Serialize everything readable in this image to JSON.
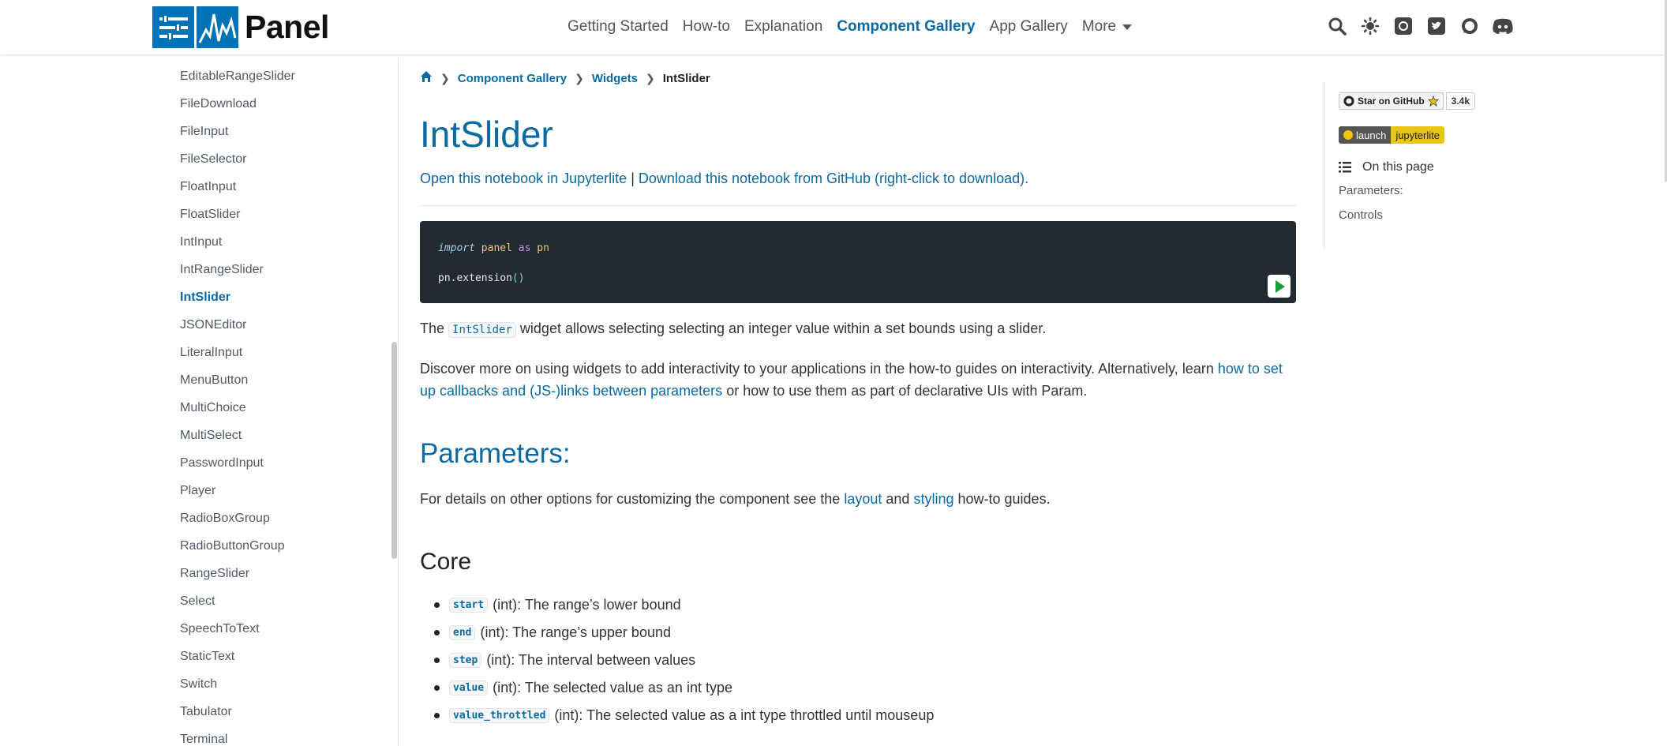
{
  "header": {
    "logo_text": "Panel",
    "nav": [
      {
        "label": "Getting Started"
      },
      {
        "label": "How-to"
      },
      {
        "label": "Explanation"
      },
      {
        "label": "Component Gallery",
        "active": true
      },
      {
        "label": "App Gallery"
      }
    ],
    "more_label": "More",
    "icons": [
      "search-icon",
      "theme-toggle-icon",
      "github-icon",
      "twitter-icon",
      "discourse-icon",
      "discord-icon"
    ]
  },
  "sidebar": {
    "items": [
      "EditableRangeSlider",
      "FileDownload",
      "FileInput",
      "FileSelector",
      "FloatInput",
      "FloatSlider",
      "IntInput",
      "IntRangeSlider",
      "IntSlider",
      "JSONEditor",
      "LiteralInput",
      "MenuButton",
      "MultiChoice",
      "MultiSelect",
      "PasswordInput",
      "Player",
      "RadioBoxGroup",
      "RadioButtonGroup",
      "RangeSlider",
      "Select",
      "SpeechToText",
      "StaticText",
      "Switch",
      "Tabulator",
      "Terminal"
    ],
    "current": "IntSlider"
  },
  "breadcrumb": {
    "items": [
      "Component Gallery",
      "Widgets"
    ],
    "current": "IntSlider"
  },
  "page": {
    "title": "IntSlider",
    "link_jupyterlite": "Open this notebook in Jupyterlite",
    "separator": "|",
    "link_github": "Download this notebook from GitHub (right-click to download).",
    "code": {
      "line1_kw": "import",
      "line1_mod": "panel",
      "line1_as": "as",
      "line1_alias": "pn",
      "line2_obj": "pn.extension",
      "line2_paren": "()"
    },
    "intro_pre": "The",
    "intro_code": "IntSlider",
    "intro_post": "widget allows selecting selecting an integer value within a set bounds using a slider.",
    "discover_text": "Discover more on using widgets to add interactivity to your applications in the how-to guides on interactivity. Alternatively, learn",
    "discover_link": "how to set up callbacks and (JS-)links between parameters",
    "discover_post": "or how to use them as part of declarative UIs with Param.",
    "parameters_heading": "Parameters:",
    "details_pre": "For details on other options for customizing the component see the",
    "details_link1": "layout",
    "details_and": "and",
    "details_link2": "styling",
    "details_post": "how-to guides.",
    "core_heading": "Core",
    "params": [
      {
        "name": "start",
        "desc": "(int): The range’s lower bound"
      },
      {
        "name": "end",
        "desc": "(int): The range’s upper bound"
      },
      {
        "name": "step",
        "desc": "(int): The interval between values"
      },
      {
        "name": "value",
        "desc": "(int): The selected value as an int type"
      },
      {
        "name": "value_throttled",
        "desc": "(int): The selected value as a int type throttled until mouseup"
      }
    ]
  },
  "toc": {
    "github_label": "Star on GitHub",
    "github_count": "3.4k",
    "launch_label": "launch",
    "jupyterlite_label": "jupyterlite",
    "heading": "On this page",
    "items": [
      "Parameters:",
      "Controls"
    ]
  }
}
